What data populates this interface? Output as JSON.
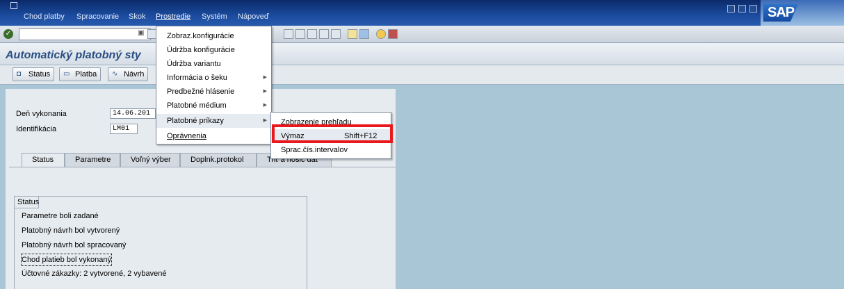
{
  "menubar": {
    "items": [
      "Chod platby",
      "Spracovanie",
      "Skok",
      "Prostredie",
      "Systém",
      "Nápoveď"
    ],
    "active_index": 3
  },
  "sap_logo": "SAP",
  "title": "Automatický platobný sty",
  "app_toolbar": {
    "buttons": [
      {
        "label": "Status",
        "icon": "status-icon"
      },
      {
        "label": "Platba",
        "icon": "payment-icon"
      },
      {
        "label": "Návrh",
        "icon": "proposal-icon"
      }
    ]
  },
  "fields": {
    "date_label": "Deň vykonania",
    "date_value": "14.06.201",
    "id_label": "Identifikácia",
    "id_value": "LM01"
  },
  "tabs": [
    "Status",
    "Parametre",
    "Voľný výber",
    "Doplnk.protokol",
    "Triť a nosič dát"
  ],
  "status_box": {
    "title": "Status",
    "rows": [
      "Parametre boli zadané",
      "Platobný návrh bol vytvorený",
      "Platobný návrh bol spracovaný",
      "Chod platieb bol vykonaný",
      "Účtovné zákazky: 2 vytvorené, 2 vybavené"
    ]
  },
  "prostredie_menu": [
    {
      "label": "Zobraz.konfigurácie",
      "submenu": false
    },
    {
      "label": "Údržba konfigurácie",
      "submenu": false
    },
    {
      "label": "Údržba variantu",
      "submenu": false
    },
    {
      "label": "Informácia o šeku",
      "submenu": true
    },
    {
      "label": "Predbežné hlásenie",
      "submenu": true
    },
    {
      "label": "Platobné médium",
      "submenu": true
    },
    {
      "label": "Platobné príkazy",
      "submenu": true
    },
    {
      "label": "Oprávnenia",
      "submenu": false
    }
  ],
  "platobne_prikazy_submenu": [
    {
      "label": "Zobrazenie prehľadu",
      "shortcut": ""
    },
    {
      "label": "Výmaz",
      "shortcut": "Shift+F12"
    },
    {
      "label": "Sprac.čís.intervalov",
      "shortcut": ""
    }
  ],
  "colors": {
    "highlight": "#e8181c",
    "title": "#2a4f82",
    "menubar": "#1b4b9e"
  }
}
